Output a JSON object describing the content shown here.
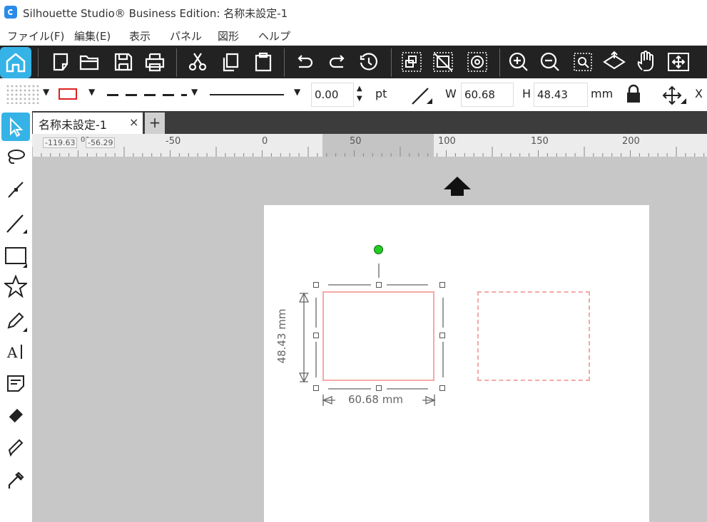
{
  "window": {
    "title": "Silhouette Studio® Business Edition: 名称未設定-1"
  },
  "menu": [
    "ファイル(F)",
    "編集(E)",
    "表示",
    "パネル",
    "図形",
    "ヘルプ"
  ],
  "toolbar": {
    "icons": [
      "home-icon",
      "new-document-icon",
      "open-folder-icon",
      "save-icon",
      "print-icon",
      "cut-icon",
      "copy-icon",
      "paste-icon",
      "undo-icon",
      "redo-icon",
      "history-icon",
      "group-icon",
      "ungroup-icon",
      "compound-path-icon",
      "zoom-in-icon",
      "zoom-out-icon",
      "zoom-selection-icon",
      "move-page-icon",
      "pan-hand-icon",
      "fit-to-page-icon"
    ]
  },
  "properties": {
    "line_width": "0.00",
    "line_unit": "pt",
    "width_label": "W",
    "width_value": "60.68",
    "height_label": "H",
    "height_value": "48.43",
    "size_unit": "mm",
    "x_label": "X"
  },
  "tabs": {
    "document": "名称未設定-1",
    "close": "×",
    "add": "+"
  },
  "ruler": {
    "labels": [
      "-50",
      "0",
      "50",
      "100",
      "150",
      "200"
    ],
    "cursor_x": "-119.63",
    "cursor_y": "-56.29",
    "stub": "00"
  },
  "canvas": {
    "dim_width": "60.68 mm",
    "dim_height": "48.43 mm"
  },
  "colors": {
    "accent": "#35b3e6",
    "shape_stroke": "#f4a9a6",
    "toolbar_bg": "#222222"
  }
}
